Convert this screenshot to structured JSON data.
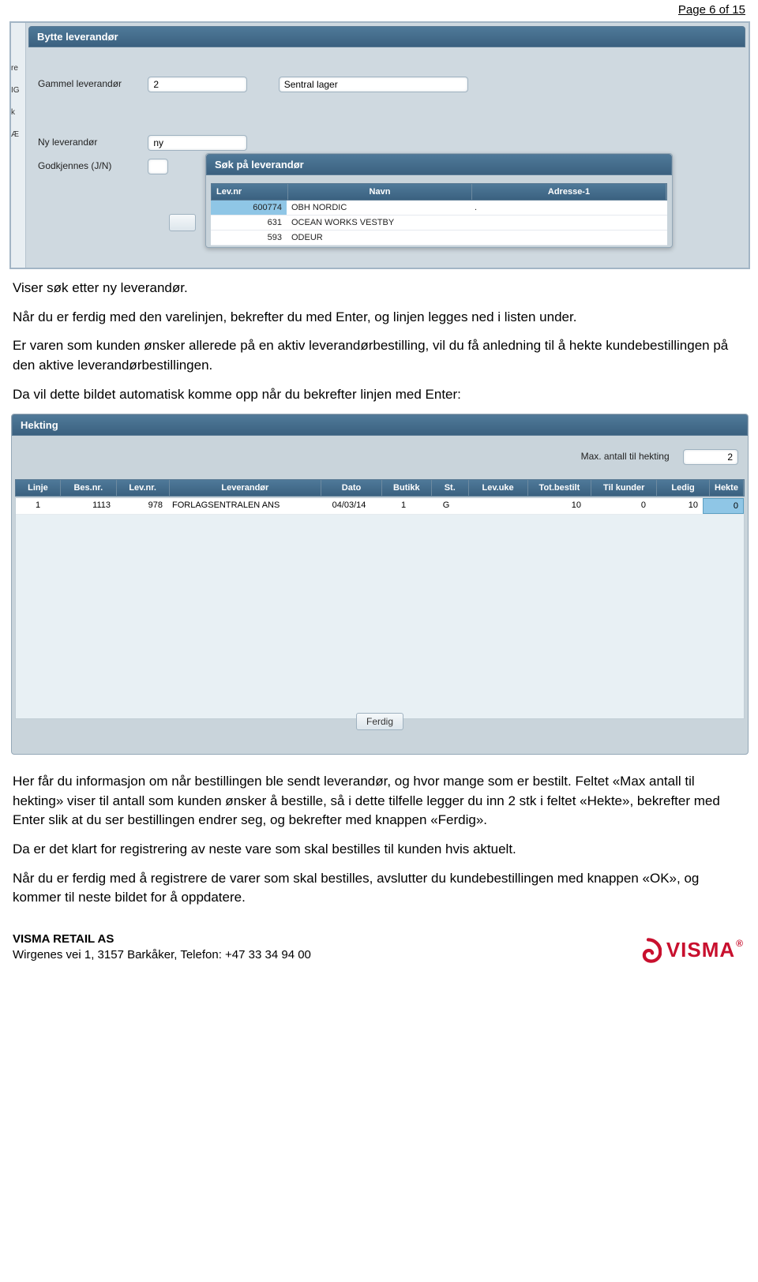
{
  "page_header": "Page 6 of 15",
  "ss1": {
    "title": "Bytte leverandør",
    "left_strip": [
      "re",
      "IG",
      "k",
      "Æ"
    ],
    "gammel_label": "Gammel leverandør",
    "gammel_id": "2",
    "gammel_navn": "Sentral lager",
    "ny_label": "Ny leverandør",
    "ny_value": "ny",
    "godkj_label": "Godkjennes (J/N)",
    "popup": {
      "title": "Søk på leverandør",
      "cols": [
        "Lev.nr",
        "Navn",
        "Adresse-1"
      ],
      "rows": [
        {
          "nr": "600774",
          "navn": "OBH NORDIC",
          "adr": "."
        },
        {
          "nr": "631",
          "navn": "OCEAN WORKS VESTBY",
          "adr": ""
        },
        {
          "nr": "593",
          "navn": "ODEUR",
          "adr": ""
        }
      ]
    }
  },
  "para": {
    "p1": "Viser søk etter ny leverandør.",
    "p2": "Når du er ferdig med den varelinjen, bekrefter du med Enter, og linjen legges ned i listen under.",
    "p3": "Er varen som kunden ønsker allerede på en aktiv leverandørbestilling, vil du få anledning til å hekte kundebestillingen på den aktive leverandørbestillingen.",
    "p4": "Da vil dette bildet automatisk komme opp når du bekrefter linjen med Enter:"
  },
  "ss2": {
    "title": "Hekting",
    "max_label": "Max. antall til hekting",
    "max_value": "2",
    "cols": [
      "Linje",
      "Bes.nr.",
      "Lev.nr.",
      "Leverandør",
      "Dato",
      "Butikk",
      "St.",
      "Lev.uke",
      "Tot.bestilt",
      "Til kunder",
      "Ledig",
      "Hekte"
    ],
    "row": {
      "linje": "1",
      "besnr": "1113",
      "levnr": "978",
      "leverandor": "FORLAGSENTRALEN ANS",
      "dato": "04/03/14",
      "butikk": "1",
      "st": "G",
      "levuke": "",
      "tot": "10",
      "tilk": "0",
      "ledig": "10",
      "hekte": "0"
    },
    "ferdig": "Ferdig"
  },
  "para2": {
    "p5": "Her får du informasjon om når bestillingen ble sendt leverandør, og hvor mange som er bestilt. Feltet «Max antall til hekting» viser til antall som kunden ønsker å bestille, så i dette tilfelle legger du inn 2 stk i feltet «Hekte», bekrefter med Enter slik at du ser bestillingen endrer seg, og bekrefter med knappen «Ferdig».",
    "p6": "Da er det klart for registrering av neste vare som skal bestilles til kunden hvis aktuelt.",
    "p7": "Når du er ferdig med å registrere de varer som skal bestilles, avslutter du kundebestillingen med knappen «OK», og kommer til neste bildet for å oppdatere."
  },
  "footer": {
    "company": "VISMA RETAIL AS",
    "address": "Wirgenes vei 1, 3157 Barkåker, Telefon: +47 33 34 94 00",
    "logo_text": "VISMA"
  }
}
